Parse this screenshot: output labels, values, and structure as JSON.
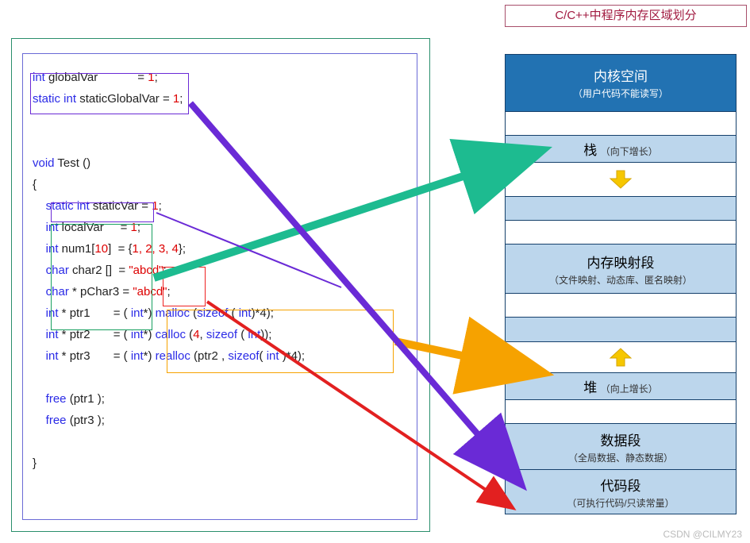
{
  "title": "C/C++中程序内存区域划分",
  "code": {
    "l1a": "int",
    "l1b": " globalVar            = ",
    "l1c": "1",
    "l1d": ";",
    "l2a": "static int",
    "l2b": " staticGlobalVar = ",
    "l2c": "1",
    "l2d": ";",
    "l3a": "void",
    "l3b": " Test ()",
    "l4": "{",
    "l5a": "    static int",
    "l5b": " staticVar = ",
    "l5c": "1",
    "l5d": ";",
    "l6a": "    int",
    "l6b": " localVar     = ",
    "l6c": "1",
    "l6d": ";",
    "l7a": "    int",
    "l7b": " num1[",
    "l7c": "10",
    "l7d": "]  = {",
    "l7e": "1, 2, 3, 4",
    "l7f": "};",
    "l8a": "    char",
    "l8b": " char2 []  = ",
    "l8c": "\"abcd\"",
    "l8d": ";",
    "l9a": "    char",
    "l9b": " * pChar3 = ",
    "l9c": "\"abcd\"",
    "l9d": ";",
    "l10a": "    int",
    "l10b": " * ptr1       = ( ",
    "l10c": "int",
    "l10d": "*) ",
    "l10e": "malloc",
    "l10f": " (",
    "l10g": "sizeof",
    "l10h": " ( ",
    "l10i": "int",
    "l10j": ")*4);",
    "l11a": "    int",
    "l11b": " * ptr2       = ( ",
    "l11c": "int",
    "l11d": "*) ",
    "l11e": "calloc",
    "l11f": " (",
    "l11g": "4",
    "l11h": ", ",
    "l11i": "sizeof",
    "l11j": " ( ",
    "l11k": "int",
    "l11l": "));",
    "l12a": "    int",
    "l12b": " * ptr3       = ( ",
    "l12c": "int",
    "l12d": "*) ",
    "l12e": "realloc",
    "l12f": " (ptr2 , ",
    "l12g": "sizeof",
    "l12h": "( ",
    "l12i": "int",
    "l12j": " )*4);",
    "l13a": "    free",
    "l13b": " (ptr1 );",
    "l14a": "    free",
    "l14b": " (ptr3 );",
    "l15": "}"
  },
  "mem": {
    "kernel_title": "内核空间",
    "kernel_sub": "（用户代码不能读写）",
    "stack_title": "栈",
    "stack_sub": "（向下增长）",
    "mmap_title": "内存映射段",
    "mmap_sub": "（文件映射、动态库、匿名映射）",
    "heap_title": "堆",
    "heap_sub": "（向上增长）",
    "data_title": "数据段",
    "data_sub": "（全局数据、静态数据）",
    "code_title": "代码段",
    "code_sub": "（可执行代码/只读常量）"
  },
  "arrows": {
    "green_from_static_to_stack": true,
    "orange_from_malloc_to_heap": true,
    "purple_from_globals_to_data": true,
    "red_from_abcd_to_code": true
  },
  "watermark": "CSDN @CILMY23"
}
